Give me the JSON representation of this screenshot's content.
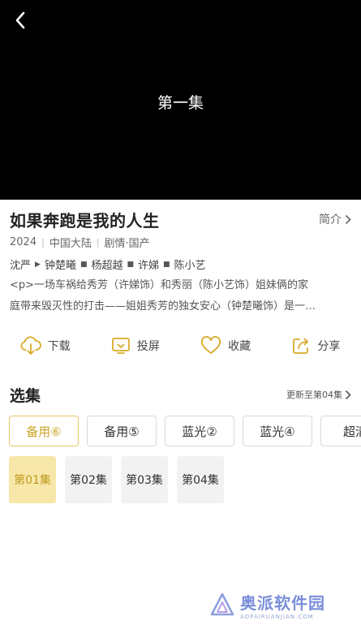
{
  "player": {
    "episode_title": "第一集"
  },
  "show": {
    "title": "如果奔跑是我的人生",
    "intro_label": "简介",
    "meta": [
      "2024",
      "中国大陆",
      "剧情·国产"
    ],
    "cast": [
      "沈严",
      "钟楚曦",
      "杨超越",
      "许娣",
      "陈小艺"
    ],
    "synopsis_line1": "<p>一场车祸给秀芳（许娣饰）和秀丽（陈小艺饰）姐妹俩的家",
    "synopsis_line2": "庭带来毁灭性的打击——姐姐秀芳的独女安心（钟楚曦饰）是一…"
  },
  "actions": {
    "download": "下载",
    "cast_screen": "投屏",
    "favorite": "收藏",
    "share": "分享"
  },
  "episodes_section": {
    "title": "选集",
    "update_label": "更新至第04集",
    "sources": [
      "备用⑥",
      "备用⑤",
      "蓝光②",
      "蓝光④",
      "超清"
    ],
    "active_source": 0,
    "episodes": [
      "第01集",
      "第02集",
      "第03集",
      "第04集"
    ],
    "active_episode": 0
  },
  "watermark": {
    "cn": "奥派软件园",
    "en": "AOPAIRUANJIAN.COM"
  },
  "colors": {
    "accent": "#c9a326",
    "active_episode_bg": "#f7e7a8",
    "watermark": "#7b8fd9"
  }
}
